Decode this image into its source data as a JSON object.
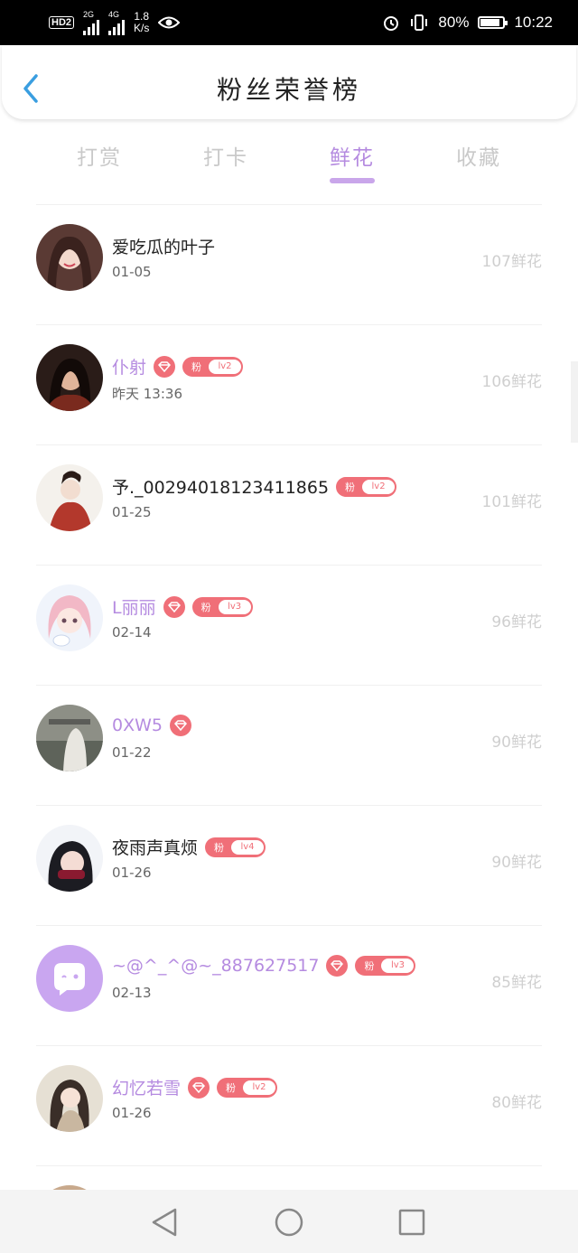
{
  "status_bar": {
    "hd": "HD",
    "hd_sub": "2",
    "net_2g": "2G",
    "net_4g": "4G",
    "speed_value": "1.8",
    "speed_unit": "K/s",
    "battery": "80%",
    "time": "10:22"
  },
  "header": {
    "title": "粉丝荣誉榜"
  },
  "tabs": [
    {
      "label": "打赏"
    },
    {
      "label": "打卡"
    },
    {
      "label": "鲜花"
    },
    {
      "label": "收藏"
    }
  ],
  "active_tab": "鲜花",
  "colors": {
    "accent": "#b58be0",
    "badge": "#f06f78",
    "count": "#cfcfcf"
  },
  "fans": [
    {
      "name": "爱吃瓜的叶子",
      "date": "01-05",
      "count": "107鲜花",
      "vip": false,
      "gem": false,
      "fan_label": "",
      "level": ""
    },
    {
      "name": "仆射",
      "date": "昨天 13:36",
      "count": "106鲜花",
      "vip": true,
      "gem": true,
      "fan_label": "粉",
      "level": "lv2"
    },
    {
      "name": "予._00294018123411865",
      "date": "01-25",
      "count": "101鲜花",
      "vip": false,
      "gem": false,
      "fan_label": "粉",
      "level": "lv2"
    },
    {
      "name": "L丽丽",
      "date": "02-14",
      "count": "96鲜花",
      "vip": true,
      "gem": true,
      "fan_label": "粉",
      "level": "lv3"
    },
    {
      "name": "0XW5",
      "date": "01-22",
      "count": "90鲜花",
      "vip": true,
      "gem": true,
      "fan_label": "",
      "level": ""
    },
    {
      "name": "夜雨声真烦",
      "date": "01-26",
      "count": "90鲜花",
      "vip": false,
      "gem": false,
      "fan_label": "粉",
      "level": "lv4"
    },
    {
      "name": "~@^_^@~_887627517",
      "date": "02-13",
      "count": "85鲜花",
      "vip": true,
      "gem": true,
      "fan_label": "粉",
      "level": "lv3"
    },
    {
      "name": "幻忆若雪",
      "date": "01-26",
      "count": "80鲜花",
      "vip": true,
      "gem": true,
      "fan_label": "粉",
      "level": "lv2"
    }
  ]
}
